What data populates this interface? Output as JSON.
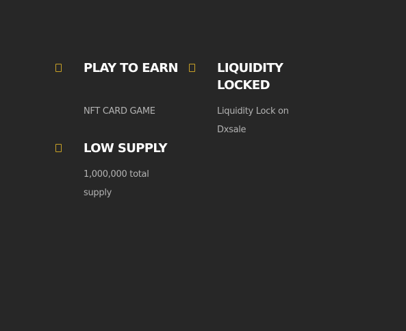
{
  "features": [
    {
      "title": "PLAY TO EARN",
      "description": "NFT CARD GAME",
      "icon": "square-outline-icon"
    },
    {
      "title": "LIQUIDITY LOCKED",
      "description": "Liquidity Lock on Dxsale",
      "icon": "square-outline-icon"
    },
    {
      "title": "LOW SUPPLY",
      "description": "1,000,000 total supply",
      "icon": "square-outline-icon"
    }
  ],
  "colors": {
    "background": "#272727",
    "title": "#ffffff",
    "description": "#b3b3b3",
    "icon_accent": "#c9a227"
  }
}
